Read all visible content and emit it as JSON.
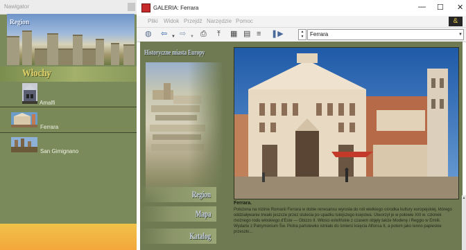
{
  "navigator": {
    "title": "Nawigator",
    "banner_label": "Region",
    "country": "Włochy",
    "cities": [
      {
        "label": "Amalfi",
        "selected": false
      },
      {
        "label": "Ferrara",
        "selected": true
      },
      {
        "label": "San Gimignano",
        "selected": false
      }
    ]
  },
  "window": {
    "title": "GALERIA: Ferrara",
    "controls": {
      "minimize": "—",
      "maximize": "☐",
      "close": "✕"
    }
  },
  "menu": [
    "Pliki",
    "Widok",
    "Przejdź",
    "Narzędzie",
    "Pomoc"
  ],
  "toolbar": {
    "icons": [
      "globe-icon",
      "back-arrow-icon",
      "forward-arrow-icon",
      "print-icon",
      "up-icon",
      "grid-icon",
      "table-icon",
      "list-icon",
      "play-icon"
    ],
    "address": "Ferrara"
  },
  "content": {
    "header": "Historyczne miasta Europy",
    "side_buttons": [
      "Region",
      "Mapa",
      "Katalog"
    ],
    "caption_title": "Ferrara.",
    "caption_text": "Położona na nizinie Romanii Ferrara w dobie renesansu wyrosła do roli wielkiego ośrodka kultury europejskiej, którego oddziaływanie trwało jeszcze przez stulecia po upadku tutejszego księstwa. Utworzył je w połowie XIII w. członek możnego rodu włoskiego d'Este — Obizzo II. Włości estefńskie z czasem objęły także Modenę i Reggio w Emilii. Wydarte z Patrymonium Św. Piotra państewko istniało do śmierci księcia Alfonsa II, a potem jako lenno papieskie przeszło..."
  },
  "colors": {
    "nav_bg": "#7a8a5a",
    "content_bg": "#6f7a52",
    "accent_yellow": "#f2b542",
    "header_text": "#c8d3e6"
  }
}
